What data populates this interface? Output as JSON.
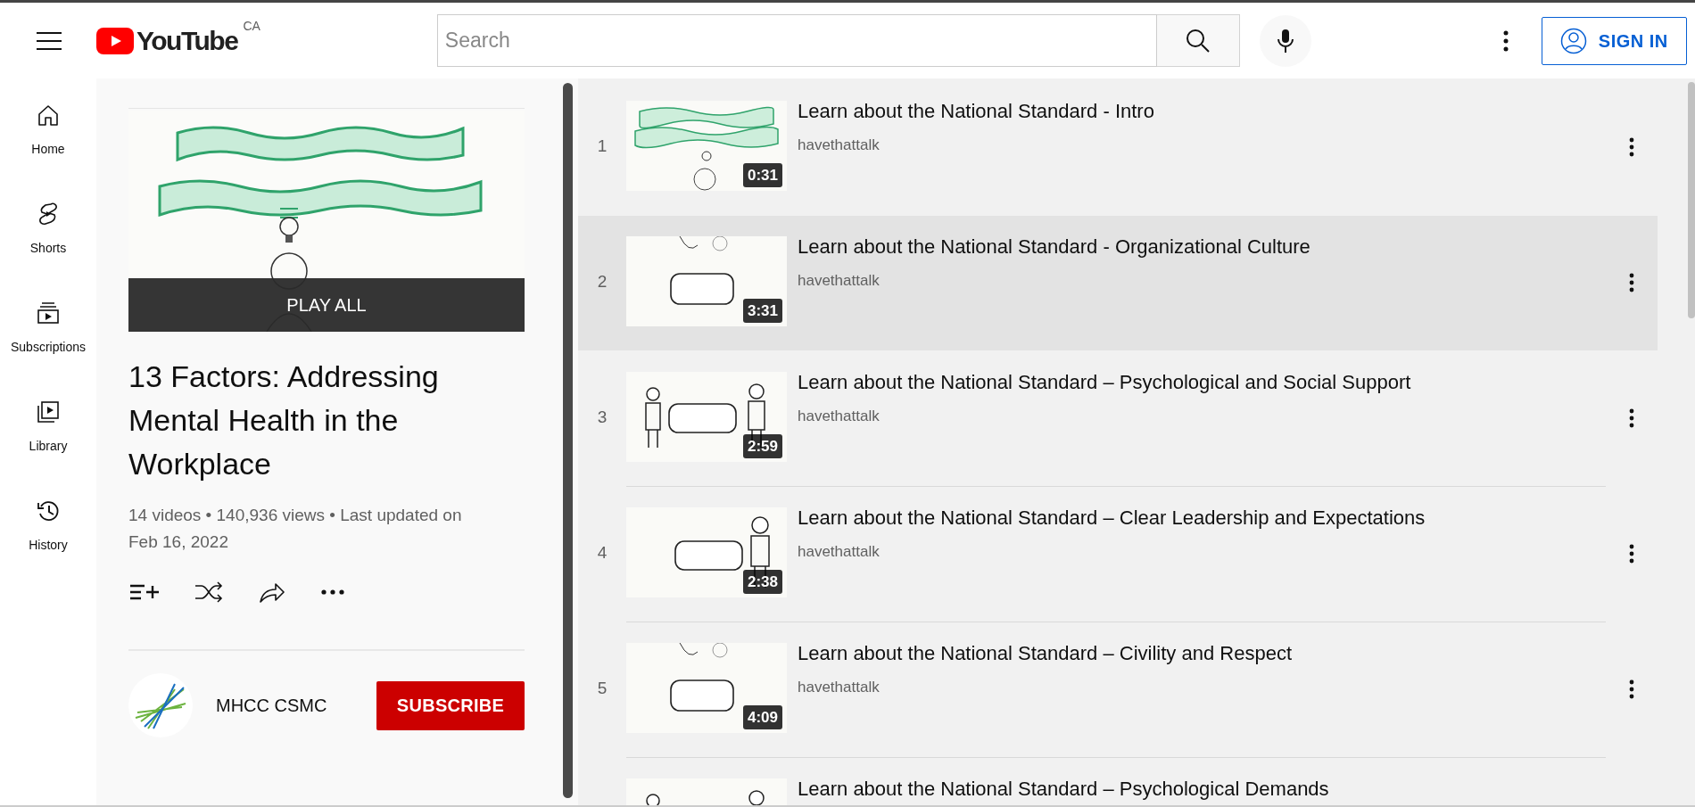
{
  "header": {
    "logo_text": "YouTube",
    "region": "CA",
    "search": {
      "placeholder": "Search"
    },
    "sign_in": "SIGN IN"
  },
  "sidebar": {
    "items": [
      {
        "label": "Home"
      },
      {
        "label": "Shorts"
      },
      {
        "label": "Subscriptions"
      },
      {
        "label": "Library"
      },
      {
        "label": "History"
      }
    ]
  },
  "playlist": {
    "play_all": "PLAY ALL",
    "title": "13 Factors: Addressing Mental Health in the Workplace",
    "stats": "14 videos • 140,936 views • Last updated on Feb 16, 2022",
    "channel": "MHCC CSMC",
    "subscribe": "SUBSCRIBE"
  },
  "videos": [
    {
      "index": "1",
      "title": "Learn about the National Standard - Intro",
      "channel": "havethattalk",
      "duration": "0:31",
      "selected": false
    },
    {
      "index": "2",
      "title": "Learn about the National Standard - Organizational Culture",
      "channel": "havethattalk",
      "duration": "3:31",
      "selected": true
    },
    {
      "index": "3",
      "title": "Learn about the National Standard – Psychological and Social Support",
      "channel": "havethattalk",
      "duration": "2:59",
      "selected": false
    },
    {
      "index": "4",
      "title": "Learn about the National Standard – Clear Leadership and Expectations",
      "channel": "havethattalk",
      "duration": "2:38",
      "selected": false
    },
    {
      "index": "5",
      "title": "Learn about the National Standard – Civility and Respect",
      "channel": "havethattalk",
      "duration": "4:09",
      "selected": false
    },
    {
      "title": "Learn about the National Standard – Psychological Demands",
      "selected": false
    }
  ]
}
